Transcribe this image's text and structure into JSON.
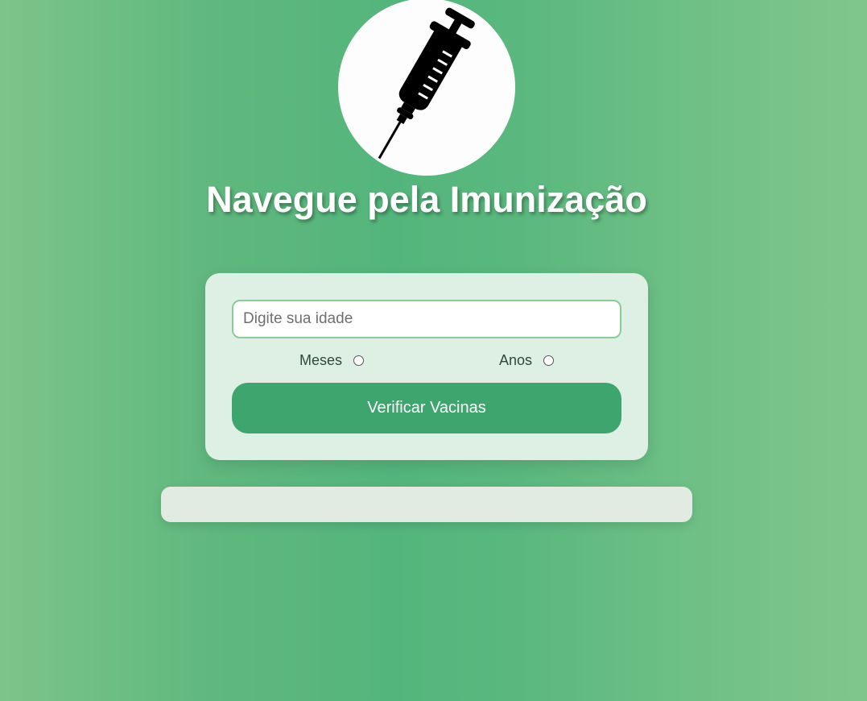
{
  "header": {
    "logo_icon": "syringe-icon",
    "title": "Navegue pela Imunização"
  },
  "form": {
    "age_placeholder": "Digite sua idade",
    "age_value": "",
    "unit_options": [
      {
        "label": "Meses",
        "selected": false
      },
      {
        "label": "Anos",
        "selected": false
      }
    ],
    "submit_label": "Verificar Vacinas"
  },
  "result": {
    "text": ""
  },
  "colors": {
    "background": "#5fb87e",
    "button": "#3ea56e",
    "input_border": "#8ccb95",
    "card": "#deefe3"
  }
}
